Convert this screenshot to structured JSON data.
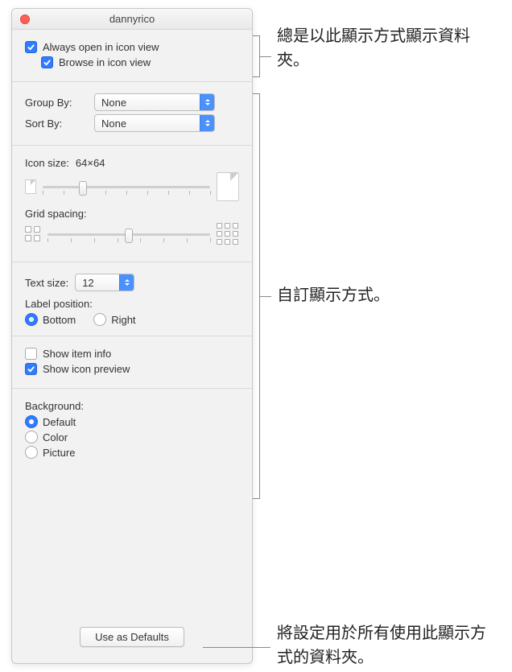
{
  "window": {
    "title": "dannyrico"
  },
  "top": {
    "always_open": {
      "label": "Always open in icon view",
      "checked": true
    },
    "browse_icon": {
      "label": "Browse in icon view",
      "checked": true
    }
  },
  "grouping": {
    "group_by_label": "Group By:",
    "group_by_value": "None",
    "sort_by_label": "Sort By:",
    "sort_by_value": "None"
  },
  "icon_size": {
    "label": "Icon size:",
    "value": "64×64",
    "slider_percent": 24
  },
  "grid_spacing": {
    "label": "Grid spacing:",
    "slider_percent": 50
  },
  "text_size": {
    "label": "Text size:",
    "value": "12"
  },
  "label_position": {
    "label": "Label position:",
    "bottom": "Bottom",
    "right": "Right",
    "selected": "bottom"
  },
  "show": {
    "item_info": {
      "label": "Show item info",
      "checked": false
    },
    "icon_preview": {
      "label": "Show icon preview",
      "checked": true
    }
  },
  "background": {
    "label": "Background:",
    "default": "Default",
    "color": "Color",
    "picture": "Picture",
    "selected": "default"
  },
  "defaults_button": "Use as Defaults",
  "annotations": {
    "a1": "總是以此顯示方式顯示資料夾。",
    "a2": "自訂顯示方式。",
    "a3": "將設定用於所有使用此顯示方式的資料夾。"
  }
}
